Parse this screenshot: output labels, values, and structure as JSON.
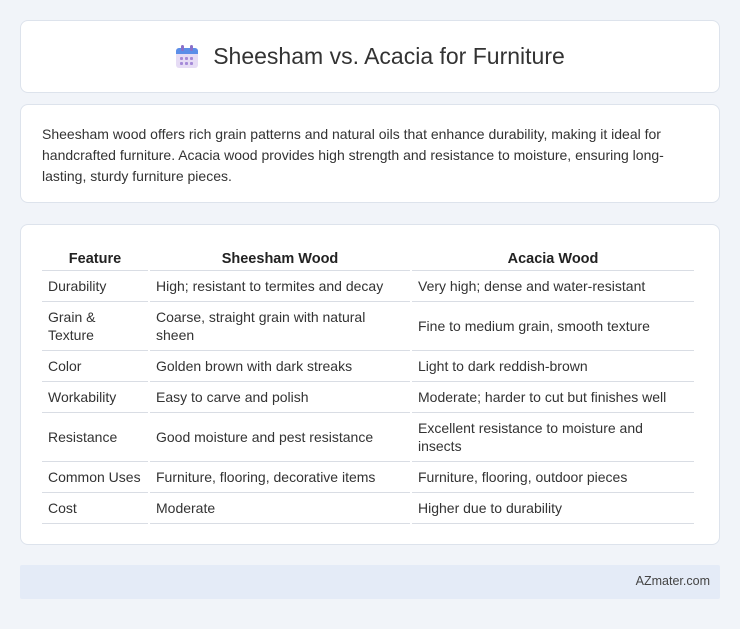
{
  "header": {
    "icon": "calendar-icon",
    "title": "Sheesham vs. Acacia for Furniture"
  },
  "intro": {
    "text": "Sheesham wood offers rich grain patterns and natural oils that enhance durability, making it ideal for handcrafted furniture. Acacia wood provides high strength and resistance to moisture, ensuring long-lasting, sturdy furniture pieces."
  },
  "table": {
    "headers": [
      "Feature",
      "Sheesham Wood",
      "Acacia Wood"
    ],
    "rows": [
      [
        "Durability",
        "High; resistant to termites and decay",
        "Very high; dense and water-resistant"
      ],
      [
        "Grain & Texture",
        "Coarse, straight grain with natural sheen",
        "Fine to medium grain, smooth texture"
      ],
      [
        "Color",
        "Golden brown with dark streaks",
        "Light to dark reddish-brown"
      ],
      [
        "Workability",
        "Easy to carve and polish",
        "Moderate; harder to cut but finishes well"
      ],
      [
        "Resistance",
        "Good moisture and pest resistance",
        "Excellent resistance to moisture and insects"
      ],
      [
        "Common Uses",
        "Furniture, flooring, decorative items",
        "Furniture, flooring, outdoor pieces"
      ],
      [
        "Cost",
        "Moderate",
        "Higher due to durability"
      ]
    ]
  },
  "footer": {
    "brand": "AZmater.com"
  },
  "colors": {
    "background": "#f1f4f9",
    "card": "#ffffff",
    "footer": "#e4ebf7"
  }
}
